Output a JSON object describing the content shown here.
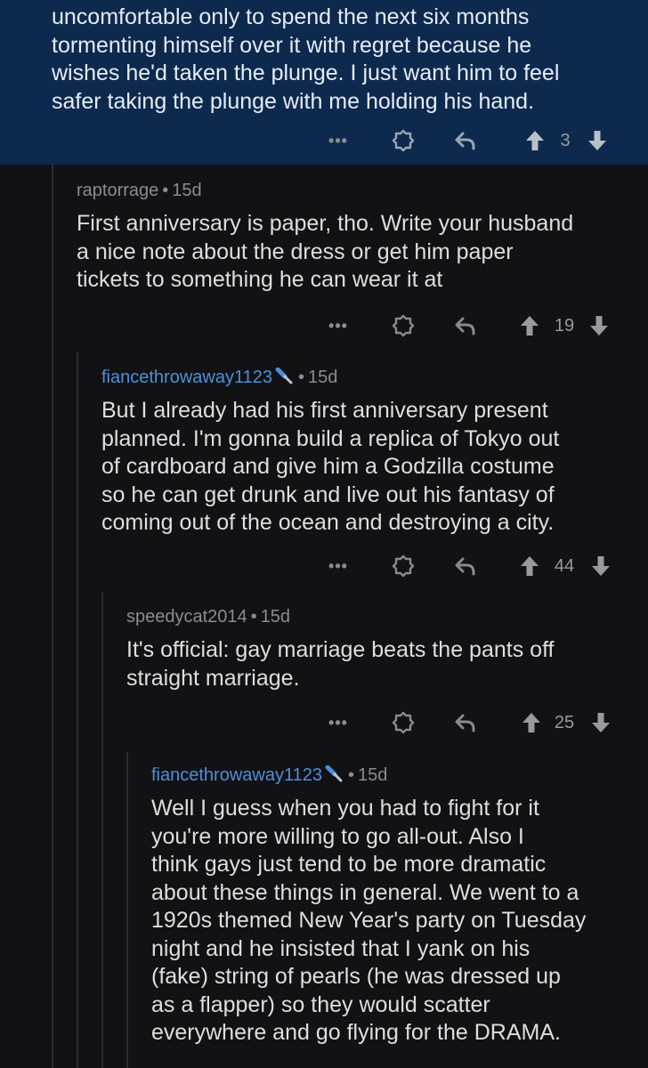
{
  "op": {
    "text_lines": [
      "uncomfortable only to spend the next six months",
      "tormenting himself over it with regret because he",
      "wishes he'd taken the plunge.  I just want him to feel",
      "safer taking the plunge with me holding his hand."
    ],
    "score": "3"
  },
  "comments": [
    {
      "username": "raptorrage",
      "age": "15d",
      "lines": [
        "First anniversary is paper, tho. Write your husband",
        "a nice note about the dress or get him paper",
        "tickets to something he can wear it at"
      ],
      "score": "19"
    },
    {
      "username": "fiancethrowaway1123",
      "age": "15d",
      "lines": [
        "But I already had his first anniversary present",
        "planned.  I'm gonna build a replica of Tokyo out",
        "of cardboard and give him a Godzilla costume",
        "so he can get drunk and live out his fantasy of",
        "coming out of the ocean and destroying a city."
      ],
      "score": "44"
    },
    {
      "username": "speedycat2014",
      "age": "15d",
      "lines": [
        "It's official: gay marriage beats the pants off",
        "straight marriage."
      ],
      "score": "25"
    },
    {
      "username": "fiancethrowaway1123",
      "age": "15d",
      "lines": [
        "Well I guess when you had to fight for it",
        "you're more willing to go all-out.  Also I",
        "think gays just tend to be more dramatic",
        "about these things in general.  We went to a",
        "1920s themed New Year's party on Tuesday",
        "night and he insisted that I yank on his",
        "(fake) string of pearls (he was dressed up",
        "as a flapper) so they would scatter",
        "everywhere and go flying for the DRAMA."
      ]
    }
  ],
  "icons": {
    "more": "more-dots-icon",
    "save": "save-badge-icon",
    "reply": "reply-arrow-icon",
    "upvote": "upvote-arrow-icon",
    "downvote": "downvote-arrow-icon",
    "op_badge": "op-mic-icon"
  },
  "colors": {
    "op_background": "#0d2a4e",
    "page_background": "#121214",
    "op_username": "#4f8fd8"
  }
}
